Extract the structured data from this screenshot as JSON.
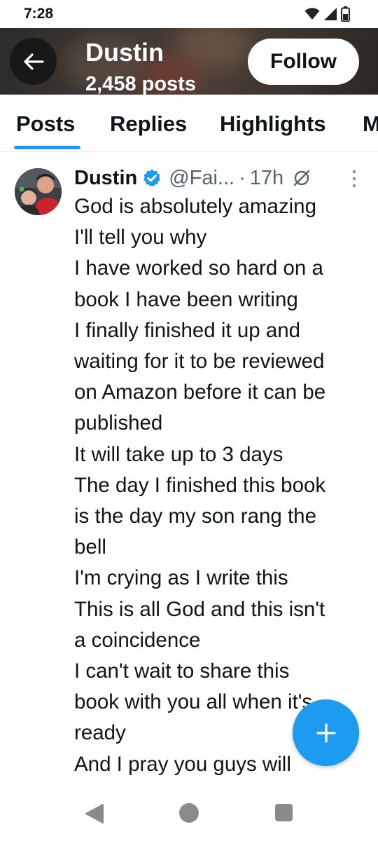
{
  "status_bar": {
    "time": "7:28"
  },
  "header": {
    "name": "Dustin",
    "posts_count": "2,458 posts",
    "follow_label": "Follow"
  },
  "tabs": [
    {
      "label": "Posts",
      "active": true
    },
    {
      "label": "Replies",
      "active": false
    },
    {
      "label": "Highlights",
      "active": false
    },
    {
      "label": "M",
      "active": false
    }
  ],
  "tweet": {
    "author": "Dustin",
    "handle": "@Fai...",
    "separator": "·",
    "time": "17h",
    "lines": [
      "God is absolutely amazing",
      "I'll tell you why",
      "I have worked so hard on a",
      "book I have been writing",
      "I finally finished it up and",
      "waiting for it to be reviewed",
      "on Amazon before it can be",
      "published",
      "It will take up to 3 days",
      "The day I finished this book",
      "is the day my son rang the",
      "bell",
      "I'm crying as I write this",
      "This is all God and this isn't",
      "a coincidence",
      "I can't wait to share this",
      "book with you all when it's",
      "ready",
      "And I pray you guys will"
    ]
  },
  "colors": {
    "accent": "#1d9bf0",
    "text_primary": "#0f1419",
    "text_secondary": "#536471"
  },
  "icons": {
    "back": "arrow-left-icon",
    "verified": "verified-badge-icon",
    "grok": "grok-icon",
    "more": "more-vertical-icon",
    "compose": "plus-icon"
  }
}
